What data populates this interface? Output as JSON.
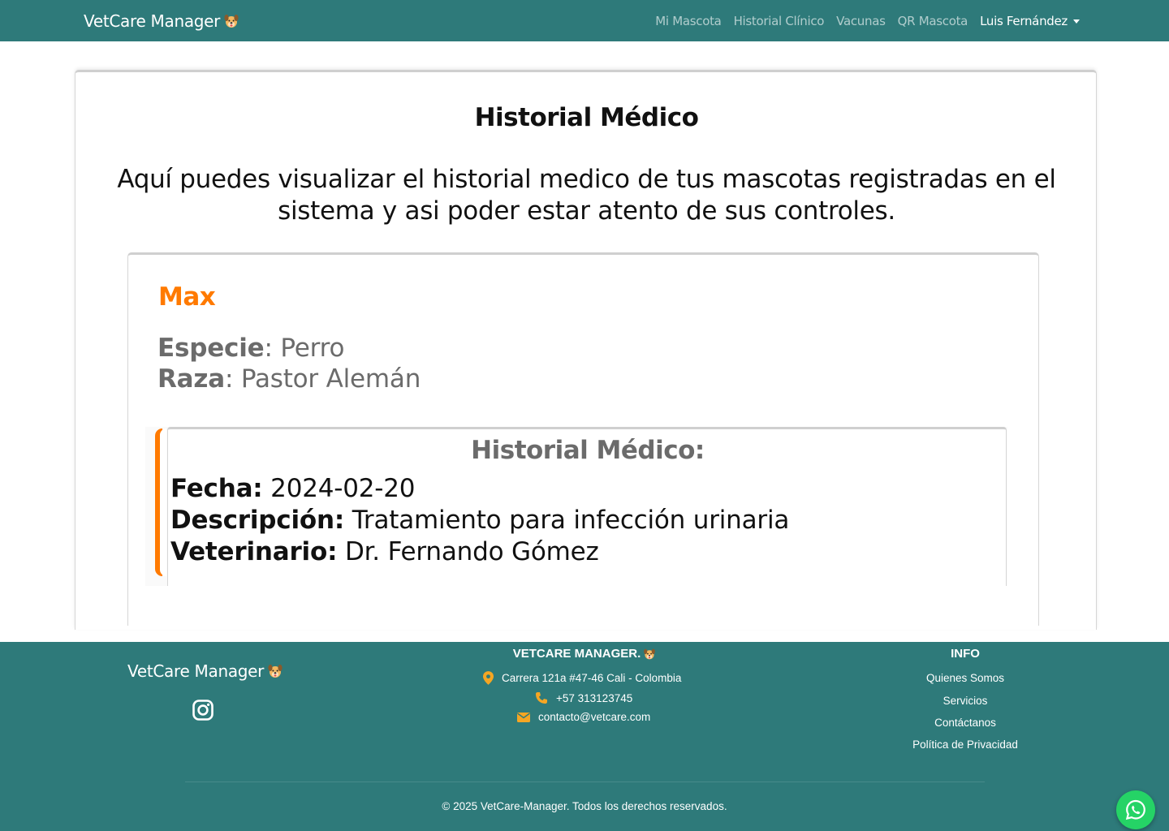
{
  "navbar": {
    "brand": "VetCare Manager",
    "links": [
      "Mi Mascota",
      "Historial Clínico",
      "Vacunas",
      "QR Mascota"
    ],
    "user": "Luis Fernández",
    "brand_icon": "dog-face-icon",
    "bg_color": "#2e7a7a"
  },
  "main": {
    "title": "Historial Médico",
    "description": "Aquí puedes visualizar el historial medico de tus mascotas registradas en el sistema y asi poder estar atento de sus controles."
  },
  "pet": {
    "name": "Max",
    "especie_label": "Especie",
    "especie": "Perro",
    "raza_label": "Raza",
    "raza": "Pastor Alemán",
    "accent_color": "#ff7a00"
  },
  "history": {
    "title": "Historial Médico:",
    "fecha_label": "Fecha:",
    "fecha": "2024-02-20",
    "descripcion_label": "Descripción:",
    "descripcion": "Tratamiento para infección urinaria",
    "veterinario_label": "Veterinario:",
    "veterinario": "Dr. Fernando Gómez"
  },
  "footer": {
    "brand": "VetCare Manager",
    "social_icon": "instagram-icon",
    "center_title": "VETCARE MANAGER.",
    "address": "Carrera 121a #47-46 Cali - Colombia",
    "phone": "+57 313123745",
    "email": "contacto@vetcare.com",
    "info_title": "INFO",
    "info_links": [
      "Quienes Somos",
      "Servicios",
      "Contáctanos",
      "Política de Privacidad"
    ],
    "copyright": "© 2025 VetCare-Manager. Todos los derechos reservados.",
    "icon_color": "#f5a623"
  },
  "whatsapp": {
    "icon": "whatsapp-icon",
    "color": "#25d366"
  }
}
